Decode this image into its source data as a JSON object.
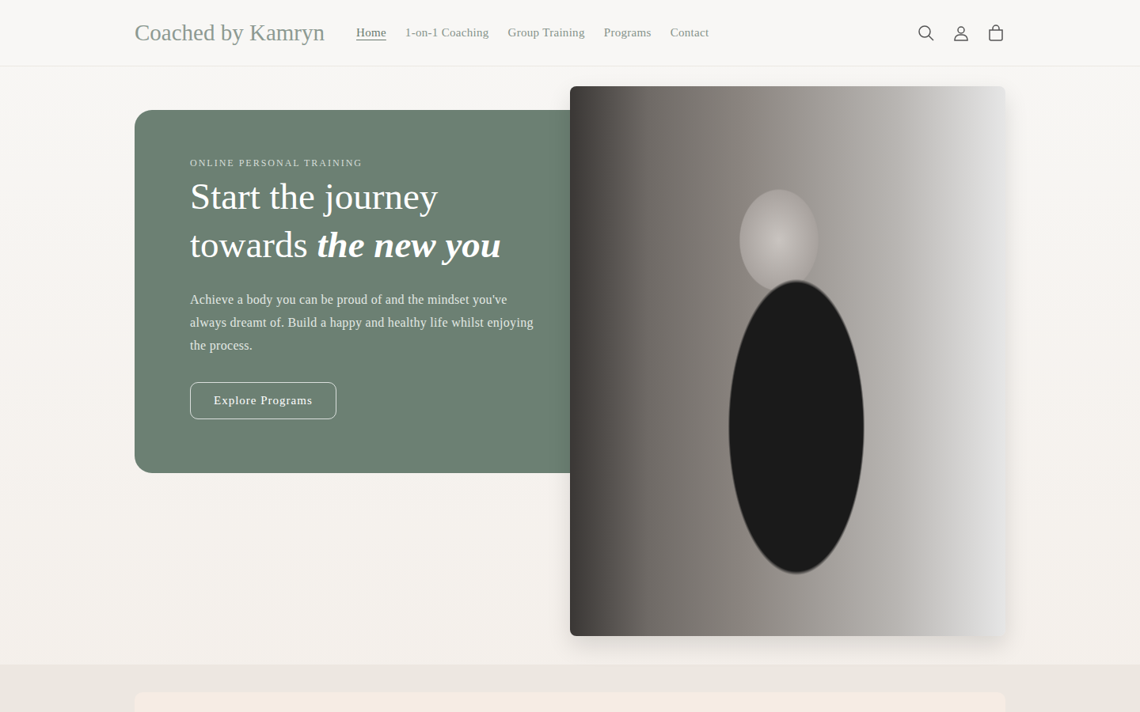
{
  "header": {
    "logo": "Coached by Kamryn",
    "nav": [
      {
        "label": "Home",
        "selected": true
      },
      {
        "label": "1-on-1 Coaching",
        "selected": false
      },
      {
        "label": "Group Training",
        "selected": false
      },
      {
        "label": "Programs",
        "selected": false
      },
      {
        "label": "Contact",
        "selected": false
      }
    ]
  },
  "hero": {
    "eyebrow": "ONLINE PERSONAL TRAINING",
    "title": "Start the journey towards ",
    "title_emphasis": "the new you",
    "body": "Achieve a body you can be proud of and the mindset you've always dreamt of. Build a happy and healthy life whilst enjoying the process.",
    "button": "Explore Programs"
  }
}
